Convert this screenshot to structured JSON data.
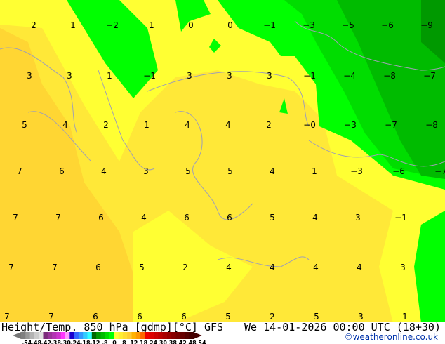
{
  "map": {
    "title": "Height/Temp. 850 hPa [gdmp][°C] GFS",
    "datetime": "We 14-01-2026 00:00 UTC (18+30)",
    "credit": "©weatheronline.co.uk",
    "region_colors": {
      "warm_orange": "#ffd633",
      "light_orange": "#ffe838",
      "yellow": "#ffff33",
      "green_bright": "#00ff00",
      "green_mid": "#00dd00",
      "green_dark": "#00bb00",
      "green_darkest": "#009900",
      "coast": "#a0a0b4"
    },
    "temperature_labels": [
      [
        "2",
        "1",
        "-2",
        "1",
        "0",
        "0",
        "-1",
        "-3",
        "-5",
        "-6",
        "-9"
      ],
      [
        "3",
        "3",
        "1",
        "-1",
        "3",
        "3",
        "3",
        "-1",
        "-4",
        "-8",
        "-7"
      ],
      [
        "5",
        "4",
        "2",
        "1",
        "4",
        "4",
        "2",
        "-0",
        "-3",
        "-7",
        "-8"
      ],
      [
        "7",
        "6",
        "4",
        "3",
        "5",
        "5",
        "4",
        "1",
        "-3",
        "-6",
        "-7"
      ],
      [
        "7",
        "7",
        "6",
        "4",
        "6",
        "6",
        "5",
        "4",
        "3",
        "-1"
      ],
      [
        "7",
        "7",
        "6",
        "5",
        "2",
        "4",
        "4",
        "4",
        "4",
        "3"
      ],
      [
        "7",
        "7",
        "6",
        "6",
        "6",
        "5",
        "2",
        "5",
        "3",
        "1"
      ]
    ]
  },
  "legend": {
    "ticks": [
      "-54",
      "-48",
      "-42",
      "-38",
      "-30",
      "-24",
      "-18",
      "-12",
      "-8",
      "0",
      "8",
      "12",
      "18",
      "24",
      "30",
      "38",
      "42",
      "48",
      "54"
    ],
    "colors": [
      "#808080",
      "#999999",
      "#b3b3b3",
      "#cccccc",
      "#e0e0e0",
      "#7a2a7a",
      "#993399",
      "#b333b3",
      "#cc33cc",
      "#ff33ff",
      "#ff99ff",
      "#1a00cc",
      "#3366ff",
      "#3399ff",
      "#33ccff",
      "#33ffff",
      "#006600",
      "#009900",
      "#00bb00",
      "#00dd00",
      "#00ff00",
      "#ffff33",
      "#ffee33",
      "#ffdd33",
      "#ffcc33",
      "#ffb300",
      "#ff9900",
      "#ff6600",
      "#ee0000",
      "#dd0000",
      "#cc0000",
      "#bb0000",
      "#aa0000",
      "#990000",
      "#880000",
      "#770000",
      "#660000",
      "#550000",
      "#440000"
    ]
  }
}
